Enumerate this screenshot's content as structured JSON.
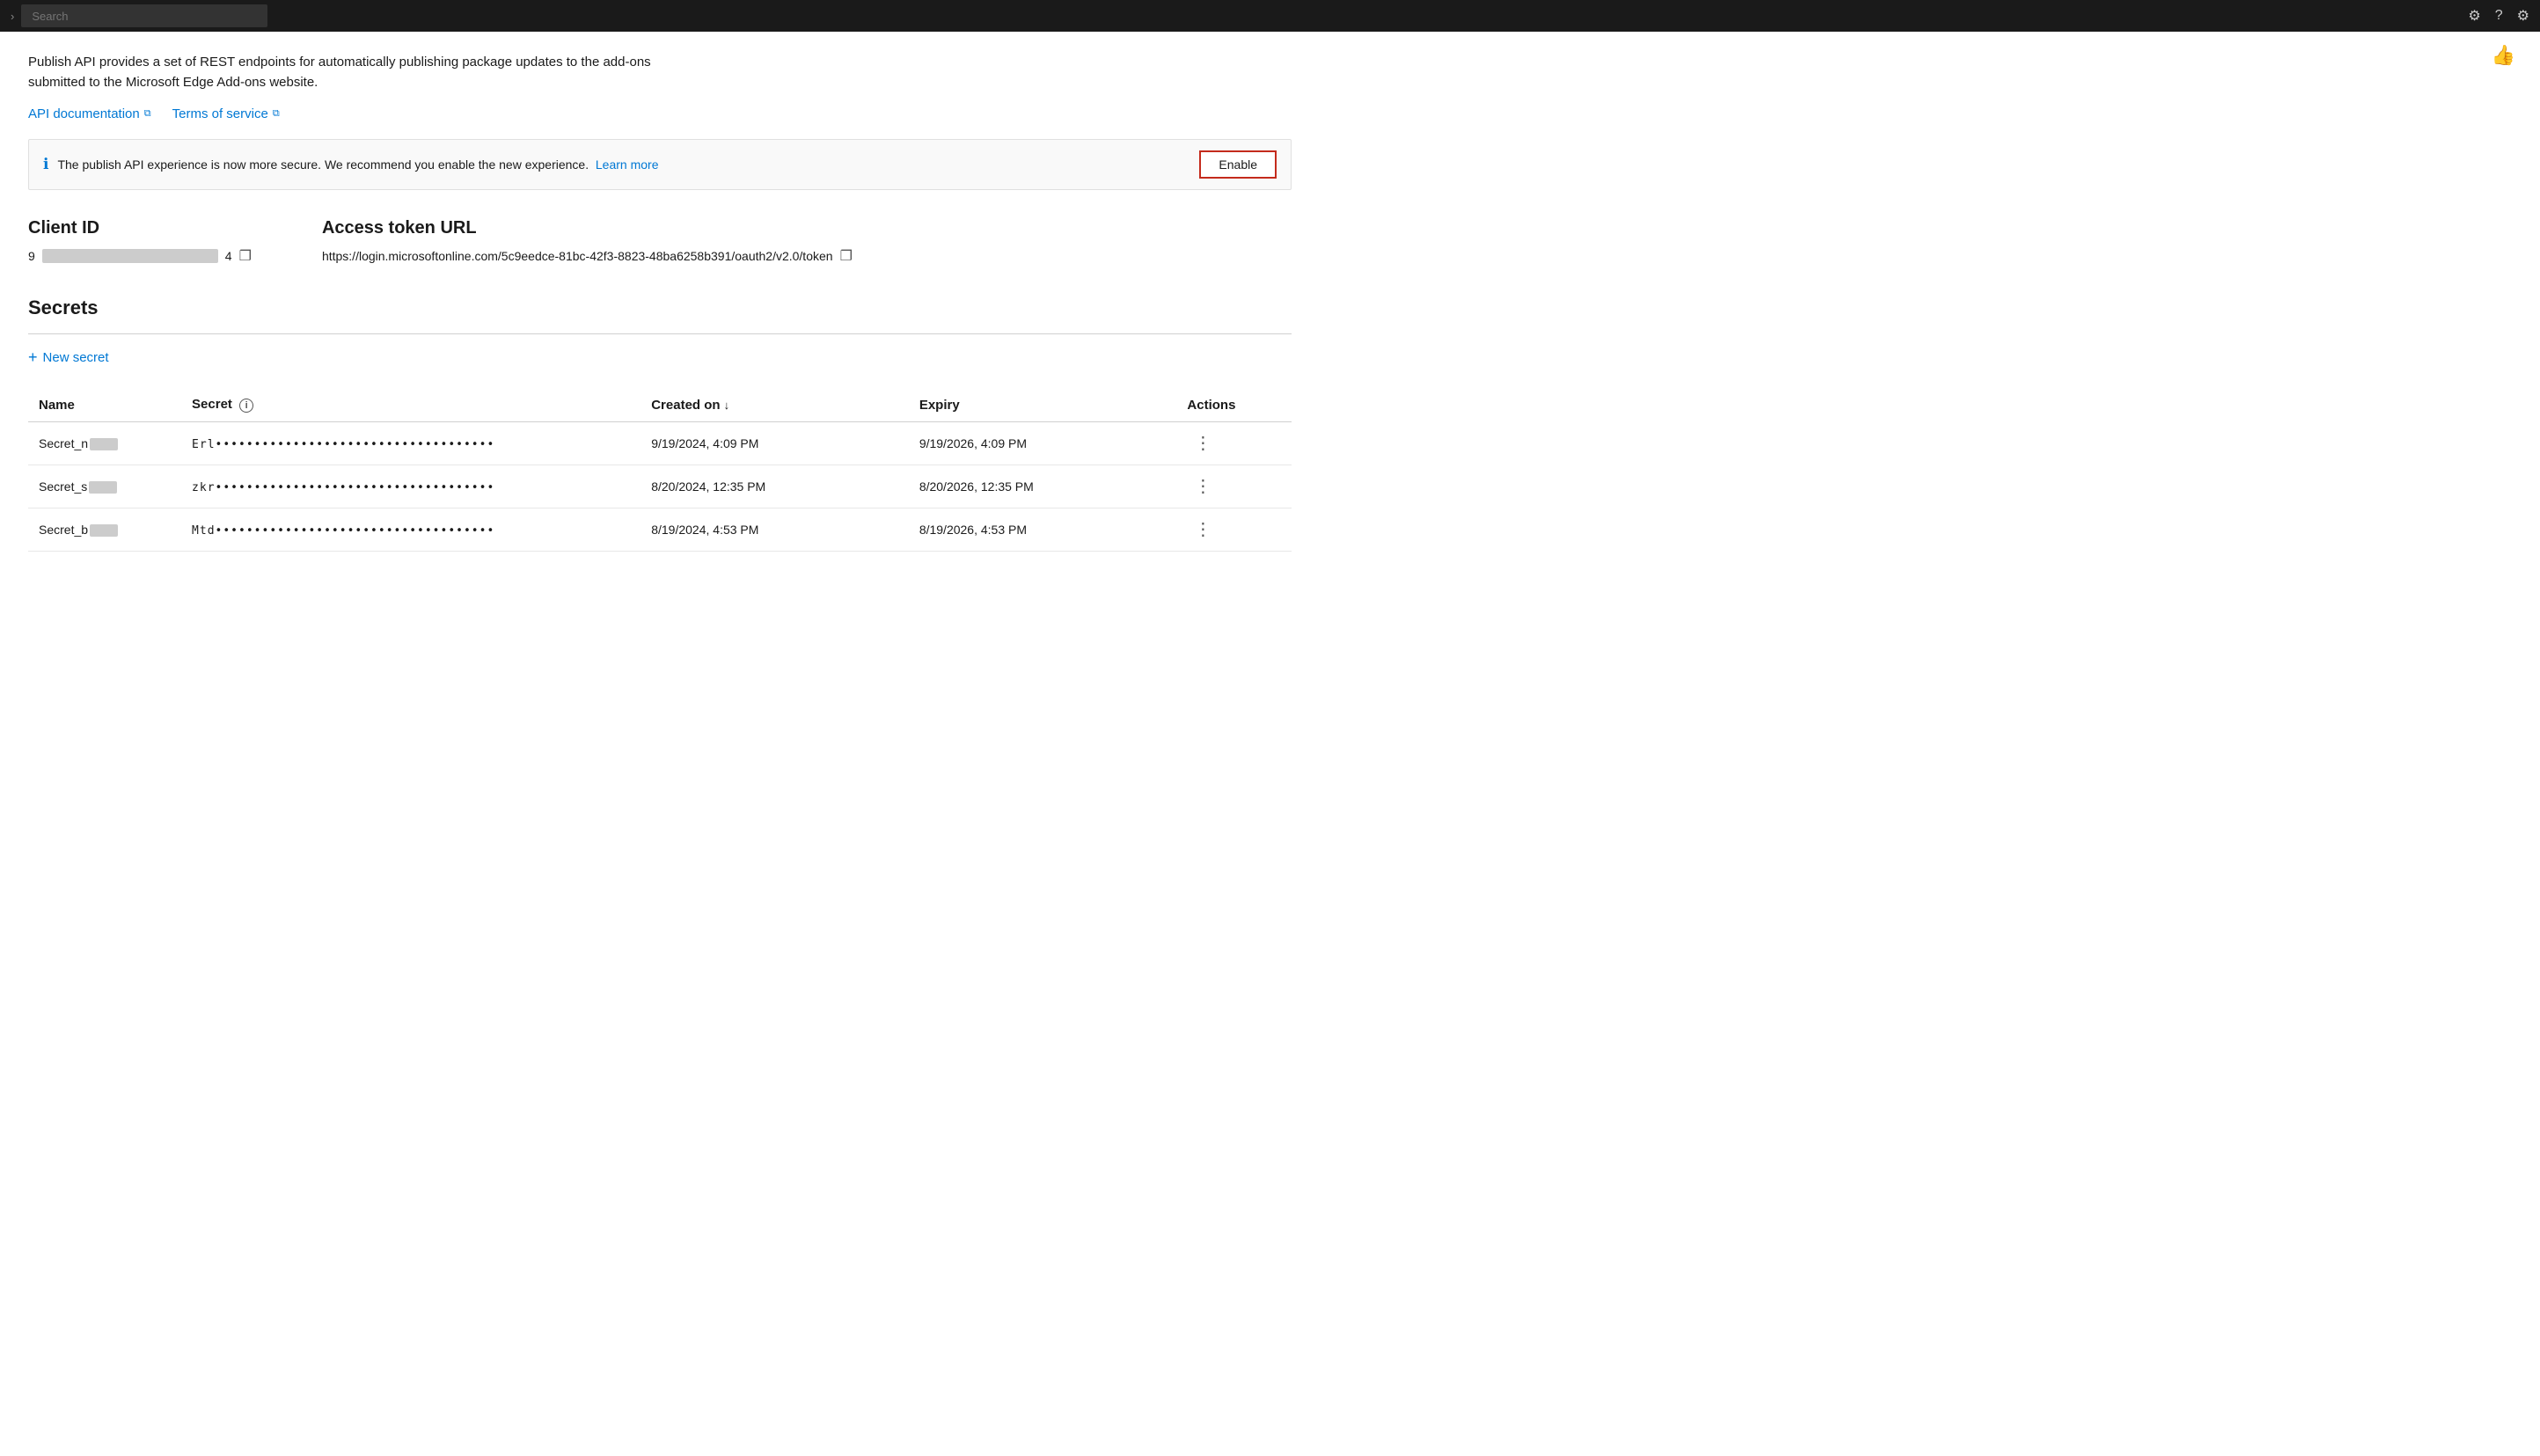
{
  "topbar": {
    "search_placeholder": "Search"
  },
  "thumbs_up_label": "👍",
  "description": {
    "line1": "Publish API provides a set of REST endpoints for automatically publishing package updates to the add-ons",
    "line2": "submitted to the Microsoft Edge Add-ons website."
  },
  "links": {
    "api_docs": "API documentation",
    "terms": "Terms of service"
  },
  "banner": {
    "message": "The publish API experience is now more secure. We recommend you enable the new experience.",
    "learn_more": "Learn more",
    "enable_button": "Enable"
  },
  "client_id": {
    "label": "Client ID",
    "prefix": "9",
    "suffix": "4",
    "copy_title": "Copy"
  },
  "access_token": {
    "label": "Access token URL",
    "url": "https://login.microsoftonline.com/5c9eedce-81bc-42f3-8823-48ba6258b391/oauth2/v2.0/token",
    "copy_title": "Copy"
  },
  "secrets": {
    "heading": "Secrets",
    "new_secret_label": "New secret",
    "columns": {
      "name": "Name",
      "secret": "Secret",
      "created_on": "Created on",
      "expiry": "Expiry",
      "actions": "Actions"
    },
    "rows": [
      {
        "name_prefix": "Secret_n",
        "secret_prefix": "Erl",
        "secret_dots": "••••••••••••••••••••••••••••••••••••",
        "created": "9/19/2024, 4:09 PM",
        "expiry": "9/19/2026, 4:09 PM"
      },
      {
        "name_prefix": "Secret_s",
        "secret_prefix": "zkr",
        "secret_dots": "••••••••••••••••••••••••••••••••••••",
        "created": "8/20/2024, 12:35 PM",
        "expiry": "8/20/2026, 12:35 PM"
      },
      {
        "name_prefix": "Secret_b",
        "secret_prefix": "Mtd",
        "secret_dots": "••••••••••••••••••••••••••••••••••••",
        "created": "8/19/2024, 4:53 PM",
        "expiry": "8/19/2026, 4:53 PM"
      }
    ]
  }
}
